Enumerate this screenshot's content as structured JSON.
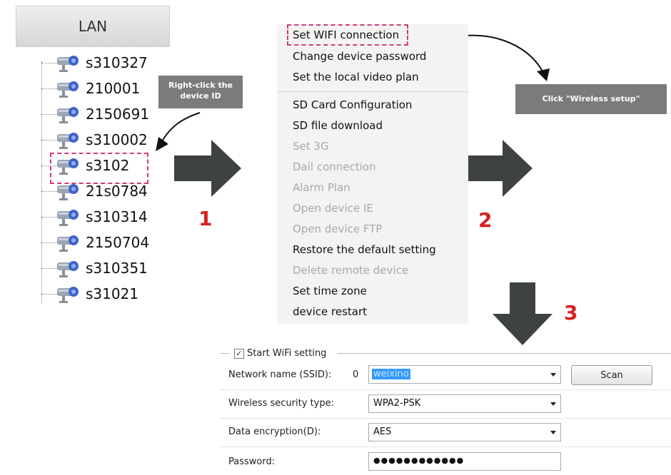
{
  "lan": {
    "title": "LAN",
    "devices": [
      "s310327",
      "210001",
      "2150691",
      "s310002",
      "s3102",
      "21s0784",
      "s310314",
      "2150704",
      "s310351",
      "s31021"
    ]
  },
  "callouts": {
    "right_click": "Right-click the device ID",
    "wireless_setup": "Click \"Wireless setup\""
  },
  "steps": [
    "1",
    "2",
    "3"
  ],
  "context_menu": {
    "items": [
      {
        "label": "Set WIFI connection",
        "enabled": true
      },
      {
        "label": "Change device password",
        "enabled": true
      },
      {
        "label": "Set the local video plan",
        "enabled": true
      },
      {
        "label": "SD Card Configuration",
        "enabled": true
      },
      {
        "label": "SD file download",
        "enabled": true
      },
      {
        "label": "Set 3G",
        "enabled": false
      },
      {
        "label": "Dail connection",
        "enabled": false
      },
      {
        "label": "Alarm Plan",
        "enabled": false
      },
      {
        "label": "Open device IE",
        "enabled": false
      },
      {
        "label": "Open device FTP",
        "enabled": false
      },
      {
        "label": "Restore the default setting",
        "enabled": true
      },
      {
        "label": "Delete remote device",
        "enabled": false
      },
      {
        "label": "Set time zone",
        "enabled": true
      },
      {
        "label": "device restart",
        "enabled": true
      }
    ]
  },
  "wifi_form": {
    "start_checkbox": {
      "label": "Start WiFi setting",
      "checked": true
    },
    "ssid": {
      "label": "Network name (SSID):",
      "signal": "0",
      "value": "weixino",
      "scan_label": "Scan"
    },
    "security": {
      "label": "Wireless security type:",
      "value": "WPA2-PSK"
    },
    "encryption": {
      "label": "Data encryption(D):",
      "value": "AES"
    },
    "password": {
      "label": "Password:",
      "value": "●●●●●●●●●●●●"
    }
  },
  "colors": {
    "highlight_dash": "#d4387d",
    "step_number": "#d92020",
    "arrow": "#3f4242",
    "callout_bg": "#7b7b7b"
  }
}
